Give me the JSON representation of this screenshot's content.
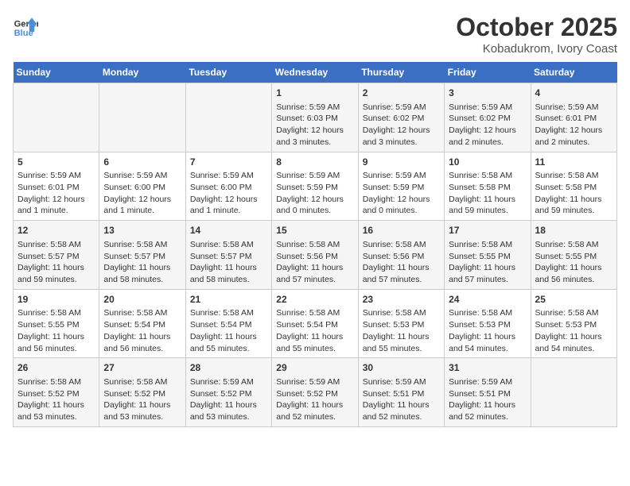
{
  "header": {
    "logo_line1": "General",
    "logo_line2": "Blue",
    "title": "October 2025",
    "subtitle": "Kobadukrom, Ivory Coast"
  },
  "weekdays": [
    "Sunday",
    "Monday",
    "Tuesday",
    "Wednesday",
    "Thursday",
    "Friday",
    "Saturday"
  ],
  "weeks": [
    [
      {
        "day": "",
        "info": ""
      },
      {
        "day": "",
        "info": ""
      },
      {
        "day": "",
        "info": ""
      },
      {
        "day": "1",
        "info": "Sunrise: 5:59 AM\nSunset: 6:03 PM\nDaylight: 12 hours and 3 minutes."
      },
      {
        "day": "2",
        "info": "Sunrise: 5:59 AM\nSunset: 6:02 PM\nDaylight: 12 hours and 3 minutes."
      },
      {
        "day": "3",
        "info": "Sunrise: 5:59 AM\nSunset: 6:02 PM\nDaylight: 12 hours and 2 minutes."
      },
      {
        "day": "4",
        "info": "Sunrise: 5:59 AM\nSunset: 6:01 PM\nDaylight: 12 hours and 2 minutes."
      }
    ],
    [
      {
        "day": "5",
        "info": "Sunrise: 5:59 AM\nSunset: 6:01 PM\nDaylight: 12 hours and 1 minute."
      },
      {
        "day": "6",
        "info": "Sunrise: 5:59 AM\nSunset: 6:00 PM\nDaylight: 12 hours and 1 minute."
      },
      {
        "day": "7",
        "info": "Sunrise: 5:59 AM\nSunset: 6:00 PM\nDaylight: 12 hours and 1 minute."
      },
      {
        "day": "8",
        "info": "Sunrise: 5:59 AM\nSunset: 5:59 PM\nDaylight: 12 hours and 0 minutes."
      },
      {
        "day": "9",
        "info": "Sunrise: 5:59 AM\nSunset: 5:59 PM\nDaylight: 12 hours and 0 minutes."
      },
      {
        "day": "10",
        "info": "Sunrise: 5:58 AM\nSunset: 5:58 PM\nDaylight: 11 hours and 59 minutes."
      },
      {
        "day": "11",
        "info": "Sunrise: 5:58 AM\nSunset: 5:58 PM\nDaylight: 11 hours and 59 minutes."
      }
    ],
    [
      {
        "day": "12",
        "info": "Sunrise: 5:58 AM\nSunset: 5:57 PM\nDaylight: 11 hours and 59 minutes."
      },
      {
        "day": "13",
        "info": "Sunrise: 5:58 AM\nSunset: 5:57 PM\nDaylight: 11 hours and 58 minutes."
      },
      {
        "day": "14",
        "info": "Sunrise: 5:58 AM\nSunset: 5:57 PM\nDaylight: 11 hours and 58 minutes."
      },
      {
        "day": "15",
        "info": "Sunrise: 5:58 AM\nSunset: 5:56 PM\nDaylight: 11 hours and 57 minutes."
      },
      {
        "day": "16",
        "info": "Sunrise: 5:58 AM\nSunset: 5:56 PM\nDaylight: 11 hours and 57 minutes."
      },
      {
        "day": "17",
        "info": "Sunrise: 5:58 AM\nSunset: 5:55 PM\nDaylight: 11 hours and 57 minutes."
      },
      {
        "day": "18",
        "info": "Sunrise: 5:58 AM\nSunset: 5:55 PM\nDaylight: 11 hours and 56 minutes."
      }
    ],
    [
      {
        "day": "19",
        "info": "Sunrise: 5:58 AM\nSunset: 5:55 PM\nDaylight: 11 hours and 56 minutes."
      },
      {
        "day": "20",
        "info": "Sunrise: 5:58 AM\nSunset: 5:54 PM\nDaylight: 11 hours and 56 minutes."
      },
      {
        "day": "21",
        "info": "Sunrise: 5:58 AM\nSunset: 5:54 PM\nDaylight: 11 hours and 55 minutes."
      },
      {
        "day": "22",
        "info": "Sunrise: 5:58 AM\nSunset: 5:54 PM\nDaylight: 11 hours and 55 minutes."
      },
      {
        "day": "23",
        "info": "Sunrise: 5:58 AM\nSunset: 5:53 PM\nDaylight: 11 hours and 55 minutes."
      },
      {
        "day": "24",
        "info": "Sunrise: 5:58 AM\nSunset: 5:53 PM\nDaylight: 11 hours and 54 minutes."
      },
      {
        "day": "25",
        "info": "Sunrise: 5:58 AM\nSunset: 5:53 PM\nDaylight: 11 hours and 54 minutes."
      }
    ],
    [
      {
        "day": "26",
        "info": "Sunrise: 5:58 AM\nSunset: 5:52 PM\nDaylight: 11 hours and 53 minutes."
      },
      {
        "day": "27",
        "info": "Sunrise: 5:58 AM\nSunset: 5:52 PM\nDaylight: 11 hours and 53 minutes."
      },
      {
        "day": "28",
        "info": "Sunrise: 5:59 AM\nSunset: 5:52 PM\nDaylight: 11 hours and 53 minutes."
      },
      {
        "day": "29",
        "info": "Sunrise: 5:59 AM\nSunset: 5:52 PM\nDaylight: 11 hours and 52 minutes."
      },
      {
        "day": "30",
        "info": "Sunrise: 5:59 AM\nSunset: 5:51 PM\nDaylight: 11 hours and 52 minutes."
      },
      {
        "day": "31",
        "info": "Sunrise: 5:59 AM\nSunset: 5:51 PM\nDaylight: 11 hours and 52 minutes."
      },
      {
        "day": "",
        "info": ""
      }
    ]
  ]
}
